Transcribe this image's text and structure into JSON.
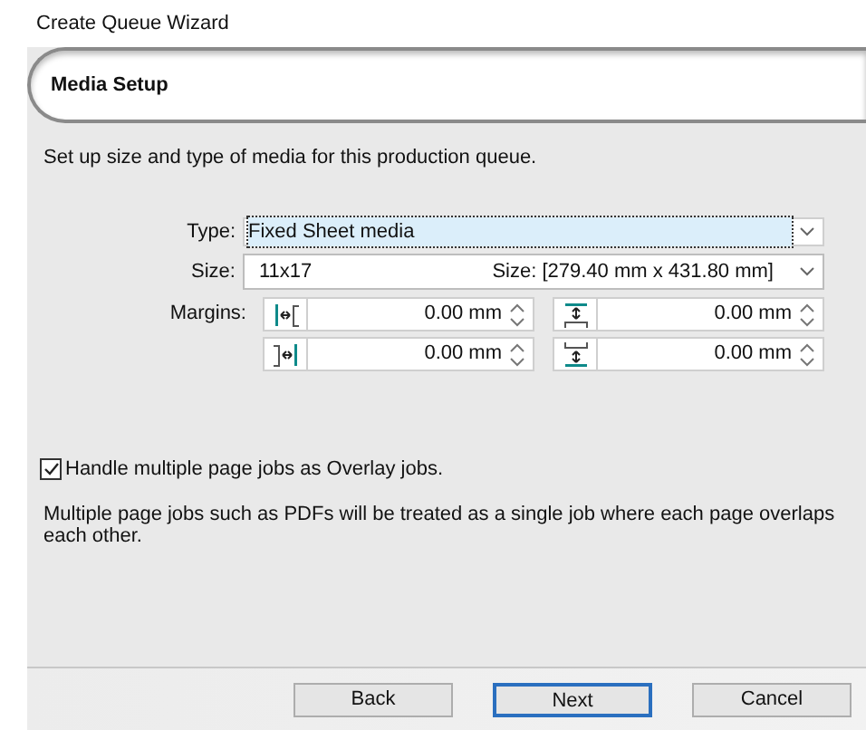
{
  "window": {
    "title": "Create Queue Wizard"
  },
  "header": {
    "title": "Media Setup"
  },
  "description": "Set up size and type of media for this production queue.",
  "type_field": {
    "label": "Type:",
    "value": "Fixed Sheet media",
    "focused": true
  },
  "size_field": {
    "label": "Size:",
    "value": "11x17",
    "size_text": "Size: [279.40 mm x 431.80 mm]"
  },
  "margins": {
    "label": "Margins:",
    "items": [
      {
        "kind": "left",
        "value": "0.00 mm"
      },
      {
        "kind": "top",
        "value": "0.00 mm"
      },
      {
        "kind": "right",
        "value": "0.00 mm"
      },
      {
        "kind": "bottom",
        "value": "0.00 mm"
      }
    ]
  },
  "overlay_checkbox": {
    "label": "Handle multiple page jobs as Overlay jobs.",
    "checked": true
  },
  "note": "Multiple page jobs such as PDFs will be treated as a single job where each page overlaps each other.",
  "buttons": [
    {
      "label": "Back",
      "default": false
    },
    {
      "label": "Next",
      "default": true
    },
    {
      "label": "Cancel",
      "default": false
    }
  ]
}
